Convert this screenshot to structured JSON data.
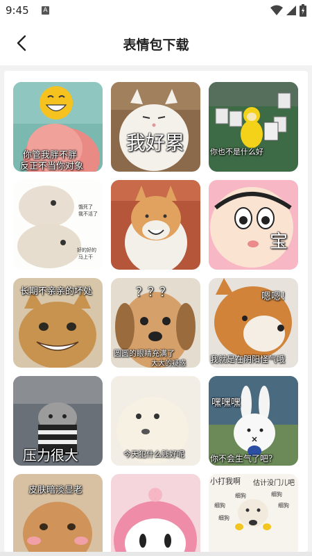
{
  "status": {
    "time": "9:45",
    "a_icon": "A"
  },
  "header": {
    "title": "表情包下载"
  },
  "stickers": [
    {
      "caption1": "你管我胖不胖",
      "caption2": "反正不当你对象"
    },
    {
      "caption1": "我好累"
    },
    {
      "caption1": "你也不是什么好"
    },
    {
      "caption1": "饿死了",
      "caption2": "我不活了",
      "caption3": "好的好的",
      "caption4": "马上干"
    },
    {
      "caption1": ""
    },
    {
      "caption1": "宝"
    },
    {
      "caption1": "长期不亲亲的坏处"
    },
    {
      "caption1": "？？？",
      "caption2": "圆圆的眼睛充满了",
      "caption3": "大大的疑惑"
    },
    {
      "caption1": "嗯嗯！",
      "caption2": "我就是在阴阳怪气哦"
    },
    {
      "caption1": "压力很大"
    },
    {
      "caption1": "今天犯什么贱好呢"
    },
    {
      "caption1": "嘿嘿嘿",
      "caption2": "你不会生气了吧？"
    },
    {
      "caption1": "皮肤暗淡显老"
    },
    {
      "caption1": ""
    },
    {
      "caption1": "小打我啊",
      "caption2": "估计没门儿吧",
      "caption3": "细狗",
      "caption4": "细狗",
      "caption5": "细狗",
      "caption6": "细狗",
      "caption7": "细狗"
    }
  ]
}
